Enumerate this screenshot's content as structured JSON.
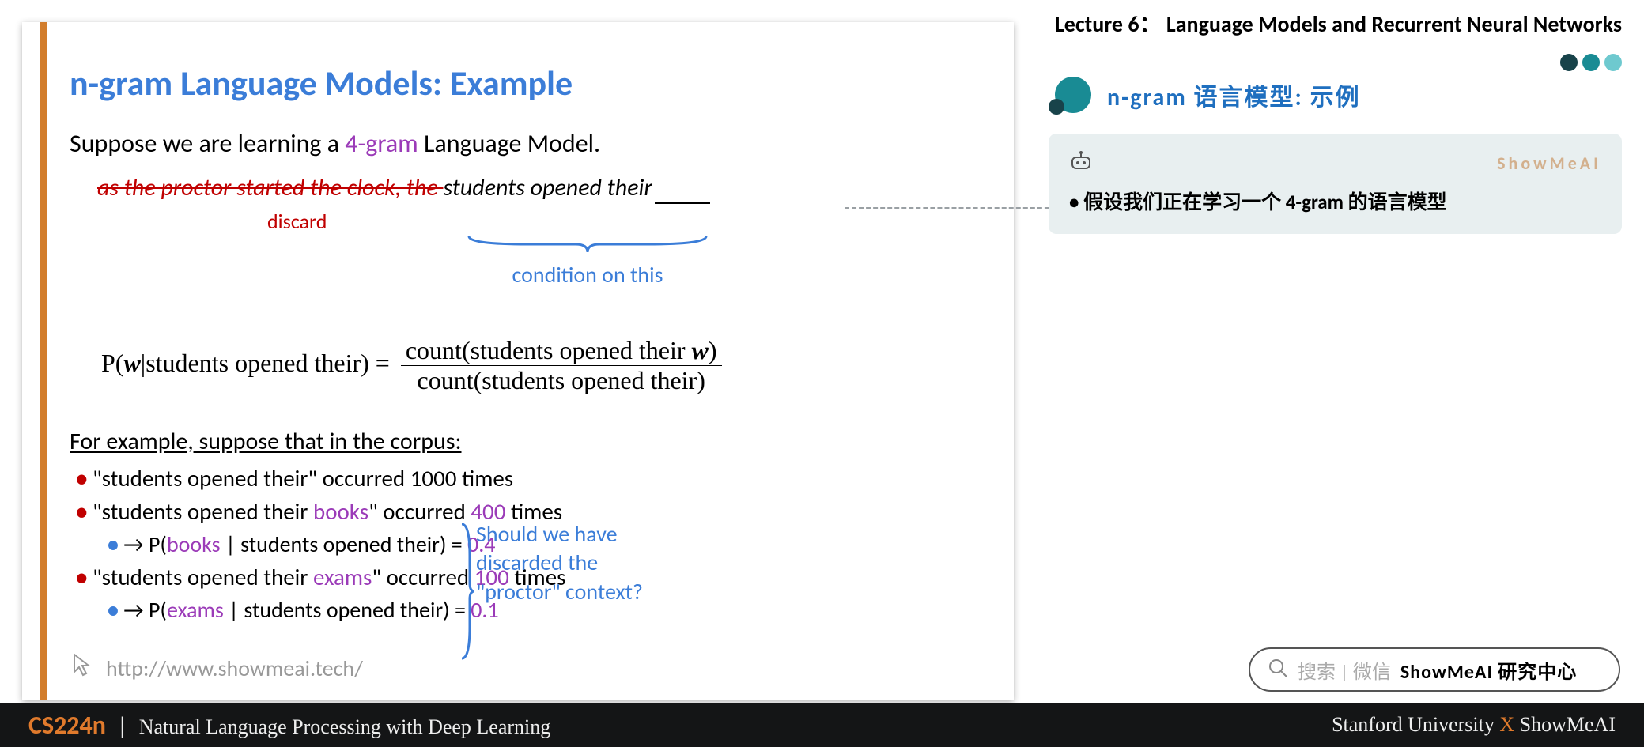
{
  "header": {
    "lecture_title": "Lecture 6： Language Models and Recurrent Neural Networks",
    "section_title": "n-gram 语言模型: 示例"
  },
  "slide": {
    "title": "n-gram Language Models: Example",
    "intro_pre": "Suppose we are learning a ",
    "intro_em": "4-gram",
    "intro_post": " Language Model.",
    "strike_text": "as the proctor started the clock, the ",
    "context_text": "students opened their",
    "discard_label": "discard",
    "condition_label": "condition on this",
    "formula": {
      "lhs_pre": "P(",
      "w": "w",
      "lhs_mid": "|students opened their) = ",
      "num": "count(students opened their w)",
      "den": "count(students opened their)"
    },
    "corpus_head": "For example, suppose that in the corpus:",
    "items": [
      {
        "pre": "\"students opened their\" occurred ",
        "n": "1000",
        "post": " times"
      },
      {
        "pre": "\"students opened their ",
        "w": "books",
        "mid": "\" occurred ",
        "n": "400",
        "post": " times"
      },
      {
        "arrow": "→",
        "pre": " P(",
        "w": "books",
        "mid": " | students opened their) = ",
        "v": "0.4"
      },
      {
        "pre": "\"students opened their ",
        "w": "exams",
        "mid": "\" occurred ",
        "n": "100",
        "post": " times"
      },
      {
        "arrow": "→",
        "pre": " P(",
        "w": "exams",
        "mid": " | students opened their) = ",
        "v": "0.1"
      }
    ],
    "side_note": "Should we have discarded the \"proctor\" context?",
    "link": "http://www.showmeai.tech/"
  },
  "note": {
    "brand": "ShowMeAI",
    "line1": "假设我们正在学习一个 4-gram 的语言模型"
  },
  "search": {
    "placeholder": "搜索 | 微信",
    "label": "ShowMeAI 研究中心"
  },
  "footer": {
    "course": "CS224n",
    "pipe": "|",
    "subtitle": "Natural Language Processing with Deep Learning",
    "right_pre": "Stanford University ",
    "right_x": "X",
    "right_post": " ShowMeAI"
  }
}
